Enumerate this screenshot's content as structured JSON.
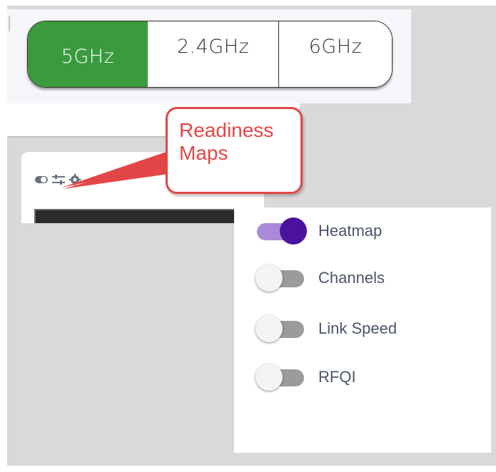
{
  "band_selector": {
    "options": [
      {
        "label": "5GHz",
        "selected": true
      },
      {
        "label": "2.4GHz",
        "selected": false
      },
      {
        "label": "6GHz",
        "selected": false
      }
    ],
    "selected_color": "#3b9a3d"
  },
  "card": {
    "icons": [
      "toggle-icon",
      "sliders-icon",
      "gear-icon"
    ]
  },
  "callout": {
    "text": "Readiness\nMaps",
    "color": "#e34646"
  },
  "layers_menu": {
    "items": [
      {
        "label": "Heatmap",
        "enabled": true
      },
      {
        "label": "Channels",
        "enabled": false
      },
      {
        "label": "Link Speed",
        "enabled": false
      },
      {
        "label": "RFQI",
        "enabled": false
      }
    ],
    "on_color": "#4b129e"
  }
}
